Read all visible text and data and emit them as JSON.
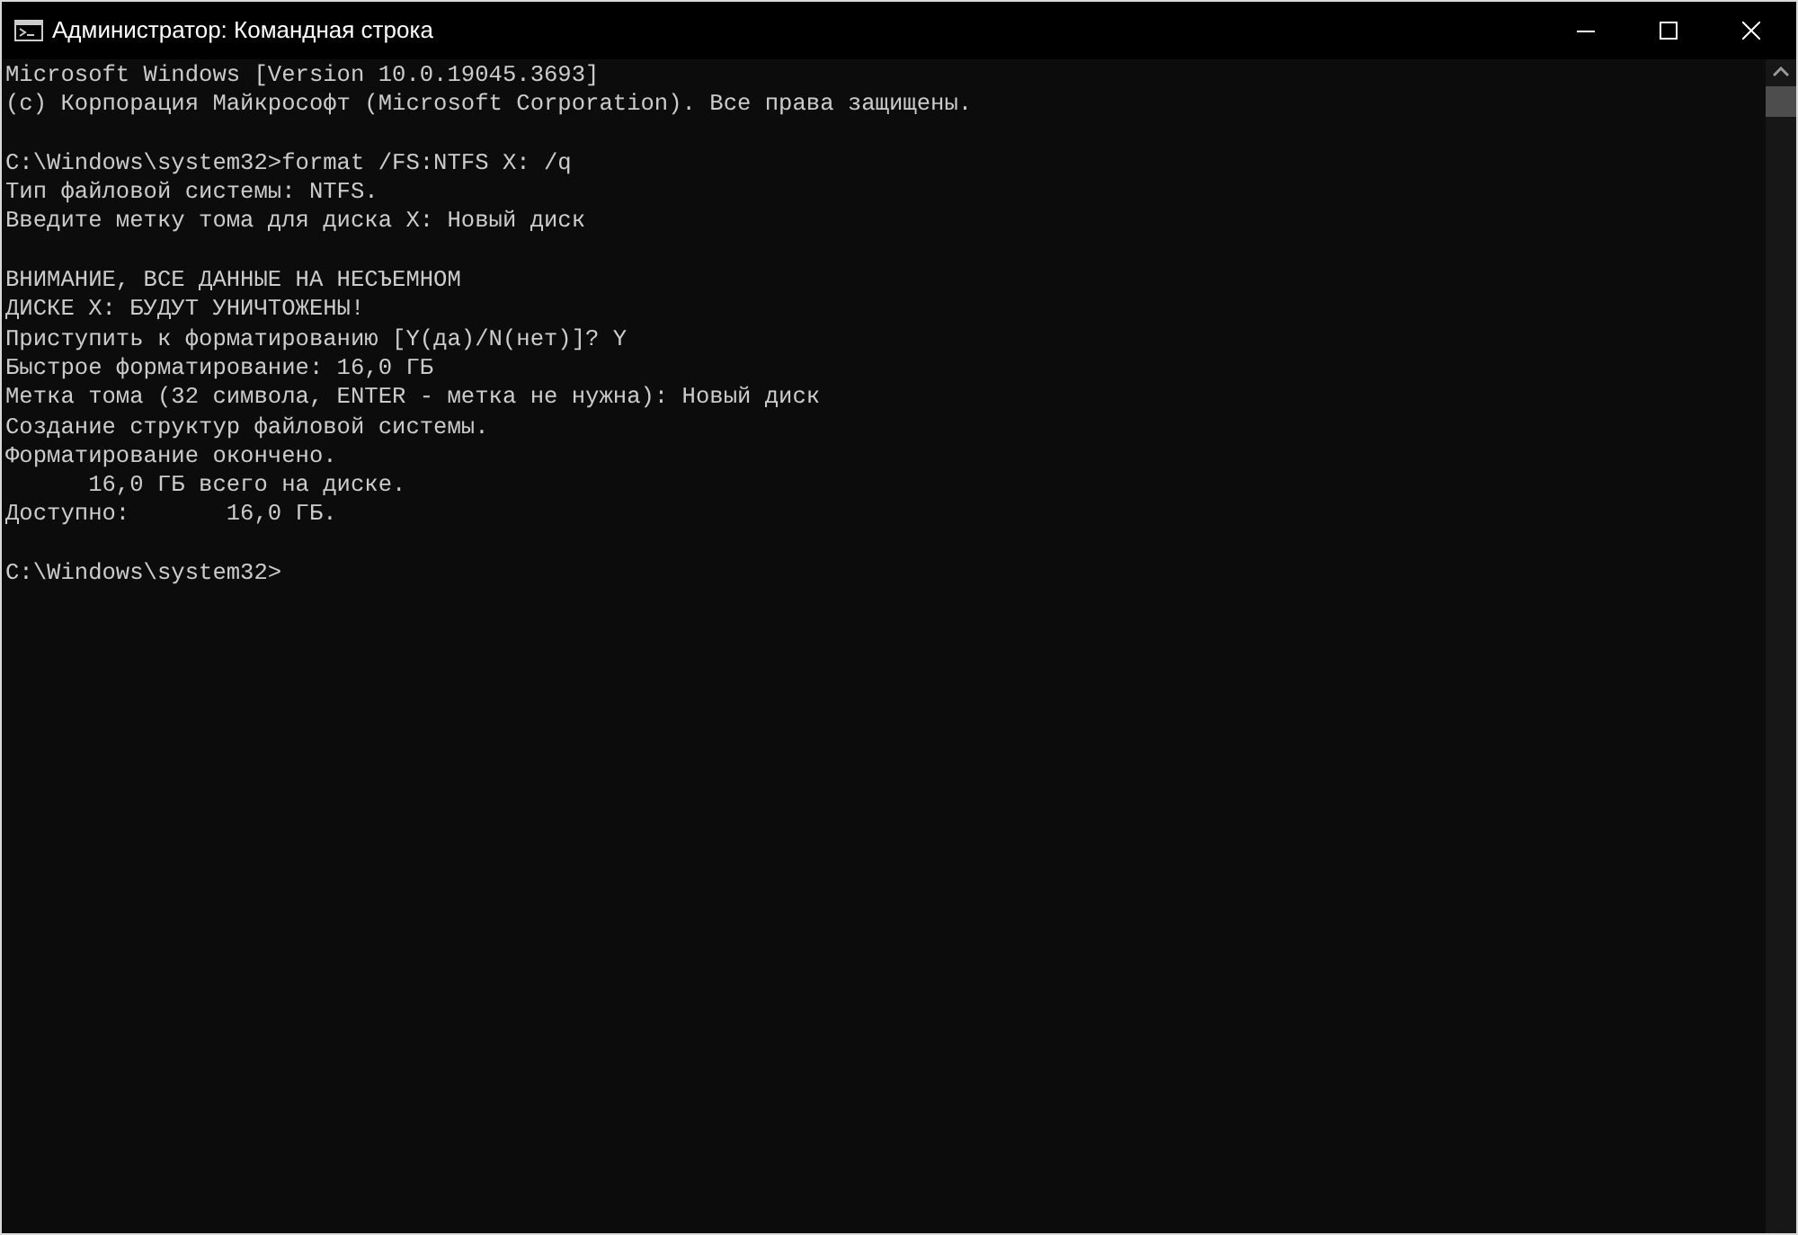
{
  "window": {
    "title": "Администратор: Командная строка"
  },
  "console": {
    "blocks": [
      [
        "Microsoft Windows [Version 10.0.19045.3693]",
        "(c) Корпорация Майкрософт (Microsoft Corporation). Все права защищены."
      ],
      [
        "C:\\Windows\\system32>format /FS:NTFS X: /q",
        "Тип файловой системы: NTFS.",
        "Введите метку тома для диска X: Новый диск"
      ],
      [
        "ВНИМАНИЕ, ВСЕ ДАННЫЕ НА НЕСЪЕМНОМ",
        "ДИСКЕ X: БУДУТ УНИЧТОЖЕНЫ!",
        "Приступить к форматированию [Y(да)/N(нет)]? Y",
        "Быстрое форматирование: 16,0 ГБ",
        "Метка тома (32 символа, ENTER - метка не нужна): Новый диск",
        "Создание структур файловой системы.",
        "Форматирование окончено.",
        "      16,0 ГБ всего на диске.",
        "Доступно:       16,0 ГБ."
      ],
      [
        "C:\\Windows\\system32>"
      ]
    ]
  }
}
